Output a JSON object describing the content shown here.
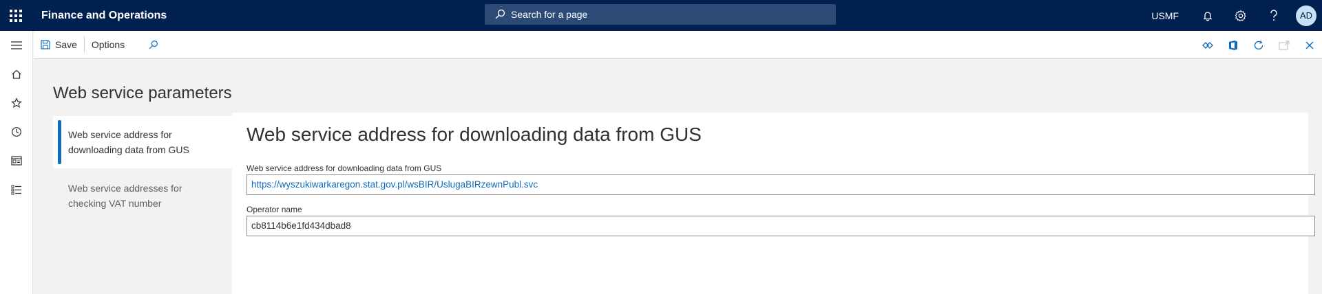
{
  "header": {
    "app_title": "Finance and Operations",
    "search_placeholder": "Search for a page",
    "company": "USMF",
    "avatar_initials": "AD"
  },
  "actionpane": {
    "save_label": "Save",
    "options_label": "Options"
  },
  "page": {
    "title": "Web service parameters"
  },
  "tabs": [
    {
      "label": "Web service address for downloading data from GUS",
      "active": true
    },
    {
      "label": "Web service addresses for checking VAT number",
      "active": false
    }
  ],
  "panel": {
    "title": "Web service address for downloading data from GUS",
    "fields": [
      {
        "label": "Web service address for downloading data from GUS",
        "value": "https://wyszukiwarkaregon.stat.gov.pl/wsBIR/UslugaBIRzewnPubl.svc"
      },
      {
        "label": "Operator name",
        "value": "cb8114b6e1fd434dbad8"
      }
    ]
  },
  "colors": {
    "nav_bar": "#002050",
    "accent": "#0f6cbd"
  }
}
